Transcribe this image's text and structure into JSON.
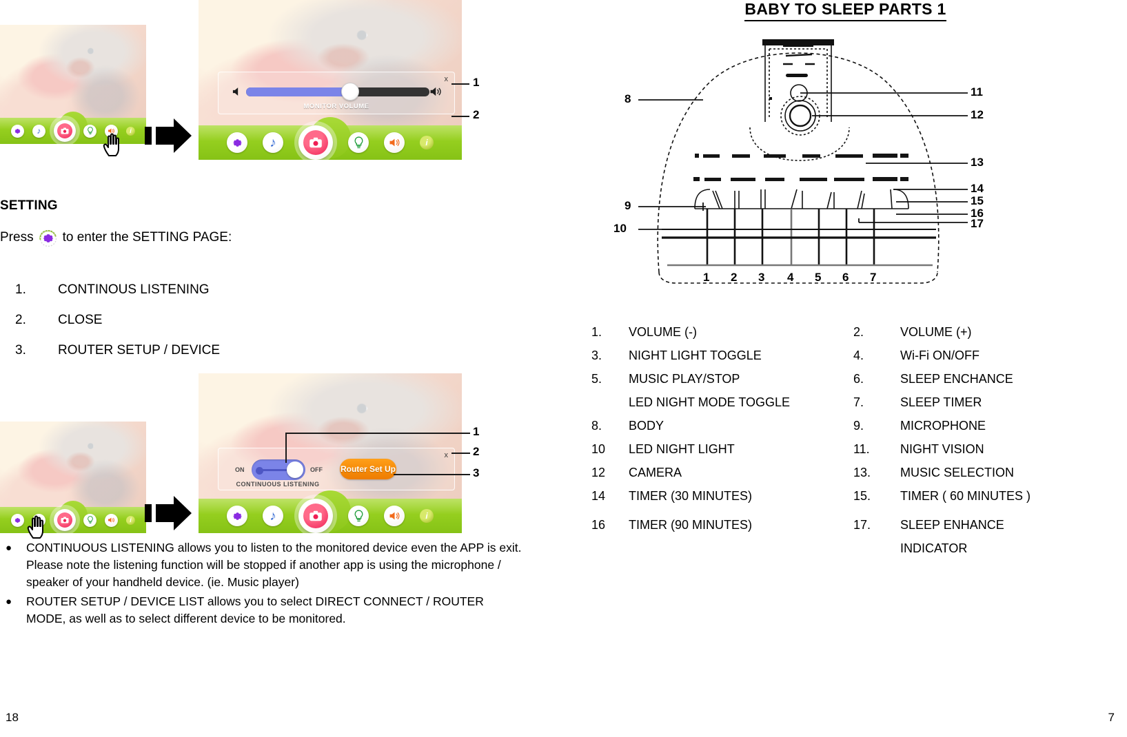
{
  "left_page": {
    "page_number": "18",
    "section_heading": "SETTING",
    "press_prefix": "Press",
    "press_suffix": "to enter the SETTING PAGE:",
    "gear_icon": "gear-icon",
    "numbered_list": [
      {
        "n": "1.",
        "label": "CONTINOUS LISTENING"
      },
      {
        "n": "2.",
        "label": "CLOSE"
      },
      {
        "n": "3.",
        "label": "ROUTER SETUP / DEVICE"
      }
    ],
    "bullets": [
      {
        "marker": "●",
        "text": "CONTINUOUS LISTENING allows you to listen to the monitored device even the APP is exit.    Please note the listening function will be stopped if another app is using the microphone / speaker of your handheld device. (ie. Music player)"
      },
      {
        "marker": "●",
        "text": "ROUTER SETUP / DEVICE LIST allows you to select DIRECT CONNECT / ROUTER MODE, as well as to select different device to be monitored."
      }
    ],
    "screenshot_volume": {
      "callouts": [
        "1",
        "2"
      ],
      "dialog_caption": "MONITOR VOLUME",
      "close_label": "x",
      "volume_percent": 55,
      "left_icon": "speaker-mute-icon",
      "right_icon": "speaker-loud-icon",
      "toolbar_icons": [
        "gear-icon",
        "music-note-icon",
        "camera-icon",
        "light-bulb-icon",
        "speaker-icon",
        "info-icon"
      ],
      "info_label": "i"
    },
    "screenshot_setting": {
      "callouts": [
        "1",
        "2",
        "3"
      ],
      "on_label": "ON",
      "off_label": "OFF",
      "switch_state": "ON",
      "dialog_caption": "CONTINUOUS LISTENING",
      "router_button_label": "Router Set Up",
      "close_label": "x",
      "toolbar_icons": [
        "gear-icon",
        "music-note-icon",
        "camera-icon",
        "light-bulb-icon",
        "speaker-icon",
        "info-icon"
      ],
      "info_label": "i"
    },
    "thumbnail_top": {
      "highlight_icon": "speaker-icon",
      "cursor": "hand-cursor-icon"
    },
    "thumbnail_bottom": {
      "highlight_icon": "gear-icon",
      "cursor": "hand-cursor-icon"
    },
    "arrow_icon": "right-arrow-icon"
  },
  "right_page": {
    "page_number": "7",
    "title": "BABY TO SLEEP PARTS 1",
    "diagram": {
      "bottom_callouts": [
        "1",
        "2",
        "3",
        "4",
        "5",
        "6",
        "7"
      ],
      "left_callouts": [
        "8",
        "9",
        "10"
      ],
      "right_callouts": [
        "11",
        "12",
        "13",
        "14",
        "15",
        "16",
        "17"
      ]
    },
    "parts_left": [
      {
        "n": "1.",
        "label": "VOLUME (-)"
      },
      {
        "n": "3.",
        "label": "NIGHT LIGHT TOGGLE"
      },
      {
        "n": "5.",
        "label": "MUSIC PLAY/STOP"
      },
      {
        "n": "",
        "label": "LED NIGHT MODE TOGGLE"
      },
      {
        "n": "8.",
        "label": "BODY"
      },
      {
        "n": "10",
        "label": "LED NIGHT LIGHT"
      },
      {
        "n": "12",
        "label": "CAMERA"
      },
      {
        "n": "14",
        "label": "TIMER (30 MINUTES)"
      },
      {
        "n": "16",
        "label": "TIMER (90 MINUTES)"
      }
    ],
    "parts_right": [
      {
        "n": "2.",
        "label": "VOLUME (+)"
      },
      {
        "n": "4.",
        "label": "Wi-Fi ON/OFF"
      },
      {
        "n": "6.",
        "label": "SLEEP ENCHANCE"
      },
      {
        "n": "7.",
        "label": "SLEEP TIMER"
      },
      {
        "n": "9.",
        "label": "MICROPHONE"
      },
      {
        "n": "11.",
        "label": "NIGHT VISION"
      },
      {
        "n": "13.",
        "label": "MUSIC SELECTION"
      },
      {
        "n": "15.",
        "label": "TIMER ( 60 MINUTES )"
      },
      {
        "n": "17.",
        "label": "SLEEP ENHANCE"
      },
      {
        "n": "",
        "label": "INDICATOR"
      }
    ]
  },
  "colors": {
    "toolbar_green": "#95cf1f",
    "slider_blue": "#7b84e8",
    "camera_pink": "#ef1f55",
    "router_orange": "#f58a08",
    "gear_purple": "#8a2be2"
  }
}
